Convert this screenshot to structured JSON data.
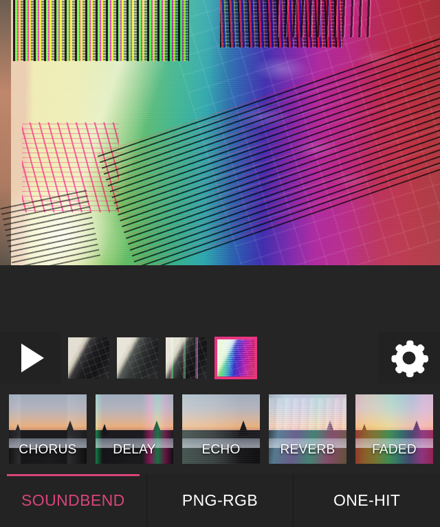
{
  "app": {
    "accent_color": "#d9447a",
    "selected_frame_border_color": "#e8357f",
    "background_color": "#252525",
    "panel_color": "#222222",
    "tab_background_color": "#232323"
  },
  "preview": {
    "name": "glitched-photo-preview",
    "subject": "keyboard on desk with rainbow channel-shift glitch",
    "alt_text": ""
  },
  "transport": {
    "play_button": {
      "icon": "play-icon",
      "label": ""
    },
    "settings_button": {
      "icon": "gear-icon",
      "label": ""
    },
    "frames": [
      {
        "name": "frame-1",
        "glitch_level": "none",
        "selected": false
      },
      {
        "name": "frame-2",
        "glitch_level": "light",
        "selected": false
      },
      {
        "name": "frame-3",
        "glitch_level": "mid",
        "selected": false
      },
      {
        "name": "frame-4",
        "glitch_level": "heavy",
        "selected": true
      }
    ]
  },
  "effects": {
    "items": [
      {
        "label": "CHORUS",
        "style": "chorus",
        "selected": false
      },
      {
        "label": "DELAY",
        "style": "delay",
        "selected": false
      },
      {
        "label": "ECHO",
        "style": "echo",
        "selected": false
      },
      {
        "label": "REVERB",
        "style": "reverb",
        "selected": false
      },
      {
        "label": "FADED",
        "style": "faded",
        "selected": false
      }
    ]
  },
  "tabs": {
    "items": [
      {
        "label": "SOUNDBEND",
        "active": true
      },
      {
        "label": "PNG-RGB",
        "active": false
      },
      {
        "label": "ONE-HIT",
        "active": false
      }
    ]
  }
}
